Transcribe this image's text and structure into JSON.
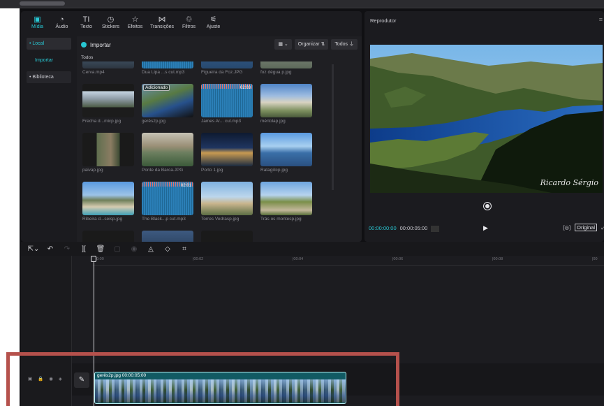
{
  "tabs": [
    {
      "label": "Mídia",
      "icon": "media-icon",
      "active": true
    },
    {
      "label": "Áudio",
      "icon": "audio-icon"
    },
    {
      "label": "Texto",
      "icon": "text-icon"
    },
    {
      "label": "Stickers",
      "icon": "sticker-icon"
    },
    {
      "label": "Efeitos",
      "icon": "effects-icon"
    },
    {
      "label": "Transições",
      "icon": "transitions-icon"
    },
    {
      "label": "Filtros",
      "icon": "filters-icon"
    },
    {
      "label": "Ajuste",
      "icon": "adjust-icon"
    }
  ],
  "sidebar": {
    "local": "• Local",
    "importar": "Importar",
    "biblioteca": "• Biblioteca"
  },
  "media": {
    "import_label": "Importar",
    "organize_label": "Organizar",
    "all_label": "Todos",
    "section": "Todos",
    "items": [
      {
        "name": "Cerva.mp4"
      },
      {
        "name": "Dua Lipa ...s cut.mp3"
      },
      {
        "name": "Figueira da Foz.JPG"
      },
      {
        "name": "foz dégua p.jpg"
      },
      {
        "name": "Frecha d...micp.jpg"
      },
      {
        "name": "gerês2p.jpg",
        "badge": "Adicionado"
      },
      {
        "name": "James Ar... cut.mp3",
        "duration": "02:03"
      },
      {
        "name": "mértolap.jpg"
      },
      {
        "name": "paivap.jpg"
      },
      {
        "name": "Ponte da Barca.JPG"
      },
      {
        "name": "Porto 1.jpg"
      },
      {
        "name": "Ratagilicp.jpg"
      },
      {
        "name": "Ribeira d...seisp.jpg"
      },
      {
        "name": "The Black...p cut.mp3",
        "duration": "02:01"
      },
      {
        "name": "Torres Vedrasp.jpg"
      },
      {
        "name": "Trás os montesp.jpg"
      }
    ]
  },
  "player": {
    "title": "Reprodutor",
    "signature": "Ricardo Sérgio",
    "current_time": "00:00:00:00",
    "total_time": "00:00:05:00",
    "original_label": "Original"
  },
  "timeline": {
    "ruler": [
      "00:00",
      "|00:02",
      "|00:04",
      "|00:06",
      "|00:08",
      "|00"
    ],
    "clip_label": "gerês2p.jpg  00:00:05:00"
  }
}
